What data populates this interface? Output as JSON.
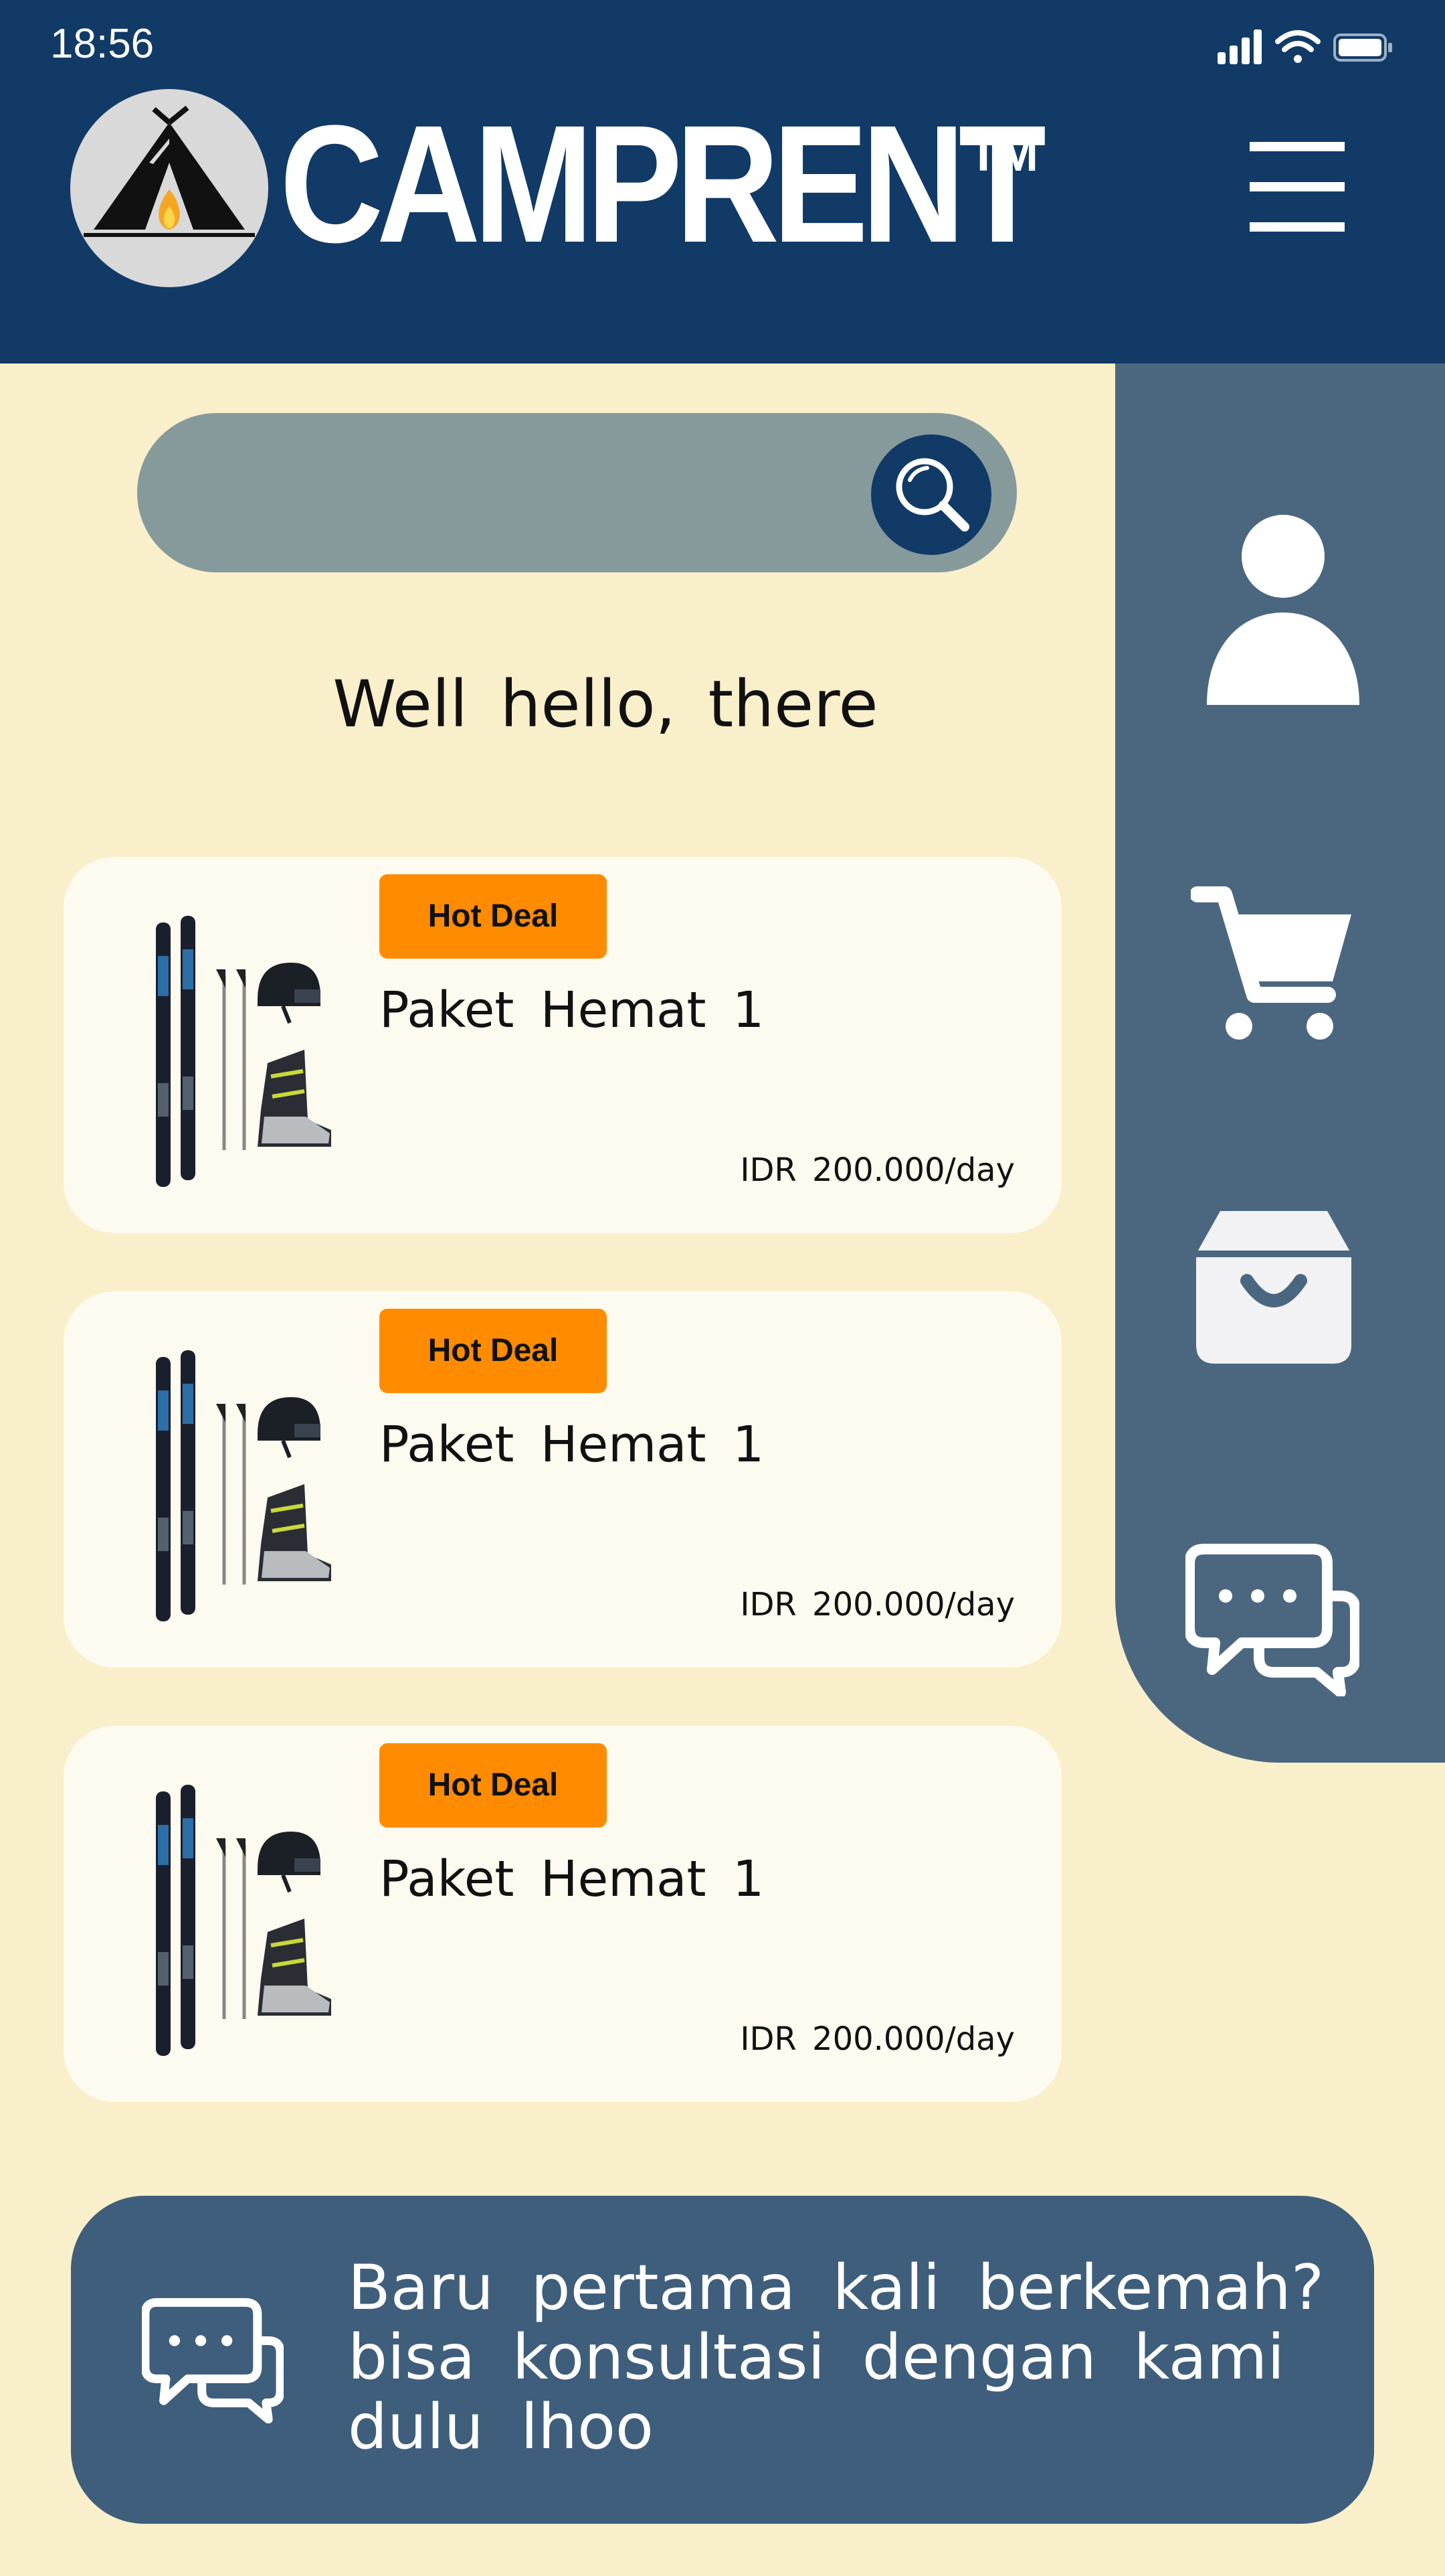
{
  "status_bar": {
    "time": "18:56"
  },
  "header": {
    "brand": "CAMPRENT",
    "trademark": "TM"
  },
  "search": {
    "placeholder": ""
  },
  "greeting": "Well hello, there",
  "cards": [
    {
      "badge": "Hot Deal",
      "title": "Paket Hemat 1",
      "price": "IDR 200.000/day"
    },
    {
      "badge": "Hot Deal",
      "title": "Paket Hemat 1",
      "price": "IDR 200.000/day"
    },
    {
      "badge": "Hot Deal",
      "title": "Paket Hemat 1",
      "price": "IDR 200.000/day"
    }
  ],
  "sidebar": {
    "items": [
      "user-icon",
      "cart-icon",
      "shopping-bag-icon",
      "chat-icon"
    ]
  },
  "consult_banner": {
    "line1": "Baru pertama kali berkemah?",
    "line2": "bisa konsultasi dengan kami",
    "line3": "dulu lhoo"
  },
  "colors": {
    "header": "#113a67",
    "background": "#f9efcb",
    "sidebar": "#4b6780",
    "badge": "#ff8c00",
    "banner": "#3e5e7b"
  }
}
